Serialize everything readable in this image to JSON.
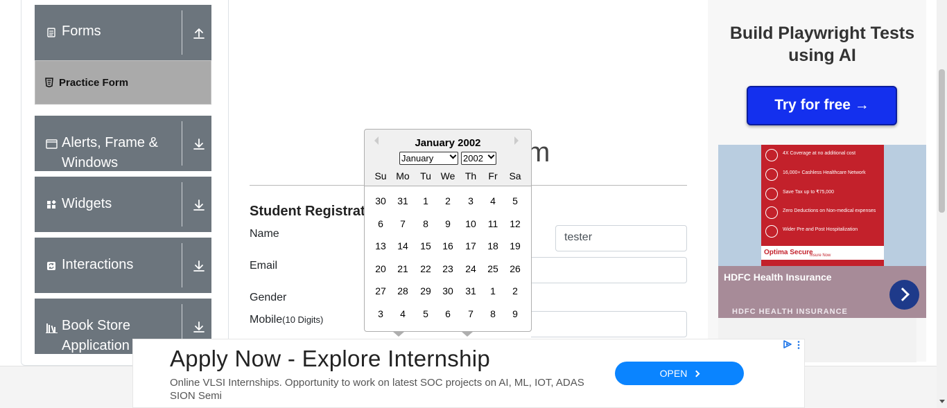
{
  "sidebar": {
    "groups": [
      {
        "name": "forms",
        "title": "Forms",
        "icon": "document-icon",
        "arrow": "collapse-arrow-icon"
      },
      {
        "name": "alerts",
        "title": "Alerts, Frame & Windows",
        "icon": "window-icon",
        "arrow": "expand-arrow-icon"
      },
      {
        "name": "widgets",
        "title": "Widgets",
        "icon": "widgets-icon",
        "arrow": "expand-arrow-icon"
      },
      {
        "name": "interactions",
        "title": "Interactions",
        "icon": "interactions-icon",
        "arrow": "expand-arrow-icon"
      },
      {
        "name": "bookstore",
        "title": "Book Store Application",
        "icon": "books-icon",
        "arrow": "expand-arrow-icon"
      }
    ],
    "active_item": "Practice Form"
  },
  "main": {
    "title_fragment": "m",
    "heading": "Student Registratio",
    "labels": {
      "name": "Name",
      "email": "Email",
      "gender": "Gender",
      "mobile": "Mobile",
      "mobile_hint": "(10 Digits)"
    },
    "last_name_value": "tester"
  },
  "datepicker": {
    "title": "January 2002",
    "month_select": "January",
    "year_select": "2002",
    "weekdays": [
      "Su",
      "Mo",
      "Tu",
      "We",
      "Th",
      "Fr",
      "Sa"
    ],
    "weeks": [
      [
        "30",
        "31",
        "1",
        "2",
        "3",
        "4",
        "5"
      ],
      [
        "6",
        "7",
        "8",
        "9",
        "10",
        "11",
        "12"
      ],
      [
        "13",
        "14",
        "15",
        "16",
        "17",
        "18",
        "19"
      ],
      [
        "20",
        "21",
        "22",
        "23",
        "24",
        "25",
        "26"
      ],
      [
        "27",
        "28",
        "29",
        "30",
        "31",
        "1",
        "2"
      ],
      [
        "3",
        "4",
        "5",
        "6",
        "7",
        "8",
        "9"
      ]
    ]
  },
  "ads": {
    "playwright": {
      "title": "Build Playwright Tests using AI",
      "button": "Try for free →"
    },
    "hdfc": {
      "items": [
        "4X Coverage at no additional cost",
        "16,000+ Cashless Healthcare Network",
        "Save Tax up to ₹75,000",
        "Zero Deductions on Non-medical expenses",
        "Wider Pre and Post Hospitalization"
      ],
      "brand": "Optima Secure",
      "cta": "Insure Now",
      "name": "HDFC Health Insurance",
      "sub": "HDFC HEALTH INSURANCE"
    },
    "bottom": {
      "title": "Apply Now - Explore Internship",
      "description": "Online VLSI Internships. Opportunity to work on latest SOC projects on AI, ML, IOT, ADAS SION Semi",
      "button": "OPEN"
    }
  },
  "colors": {
    "sidebar_bg": "#6c757d",
    "active_item_bg": "#aaaaaa",
    "ad_button_blue": "#1430ee",
    "open_button_blue": "#0a84ff"
  }
}
